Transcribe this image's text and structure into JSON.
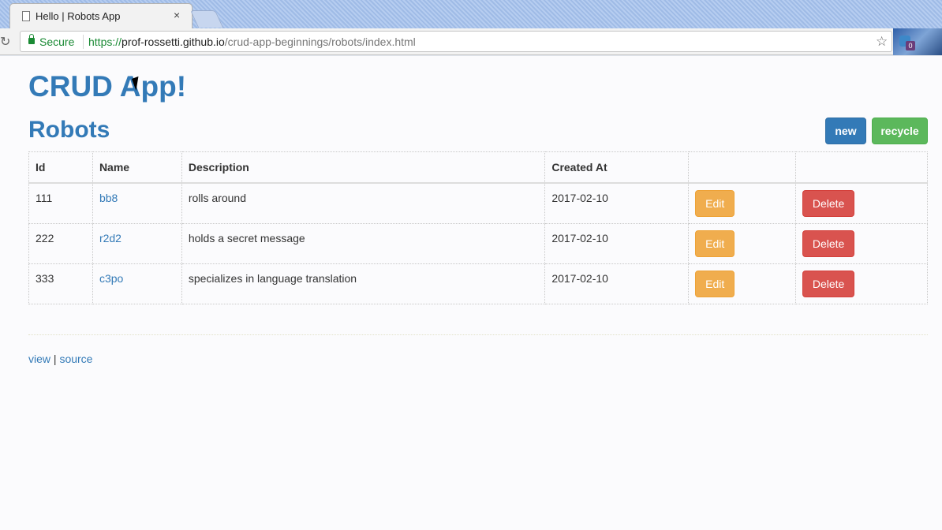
{
  "browser": {
    "tab_title": "Hello | Robots App",
    "tab_close": "×",
    "secure_label": "Secure",
    "url_scheme": "https://",
    "url_host": "prof-rossetti.github.io",
    "url_path": "/crud-app-beginnings/robots/index.html",
    "extension_badge": "0"
  },
  "page": {
    "app_title": "CRUD App!",
    "section_title": "Robots",
    "new_button": "new",
    "recycle_button": "recycle"
  },
  "table": {
    "headers": [
      "Id",
      "Name",
      "Description",
      "Created At",
      "",
      ""
    ],
    "rows": [
      {
        "id": "111",
        "name": "bb8",
        "description": "rolls around",
        "created_at": "2017-02-10",
        "edit": "Edit",
        "delete": "Delete"
      },
      {
        "id": "222",
        "name": "r2d2",
        "description": "holds a secret message",
        "created_at": "2017-02-10",
        "edit": "Edit",
        "delete": "Delete"
      },
      {
        "id": "333",
        "name": "c3po",
        "description": "specializes in language translation",
        "created_at": "2017-02-10",
        "edit": "Edit",
        "delete": "Delete"
      }
    ]
  },
  "footer": {
    "view_link": "view",
    "separator": " | ",
    "source_link": "source"
  },
  "colors": {
    "primary": "#337ab7",
    "success": "#5cb85c",
    "warning": "#f0ad4e",
    "danger": "#d9534f"
  }
}
